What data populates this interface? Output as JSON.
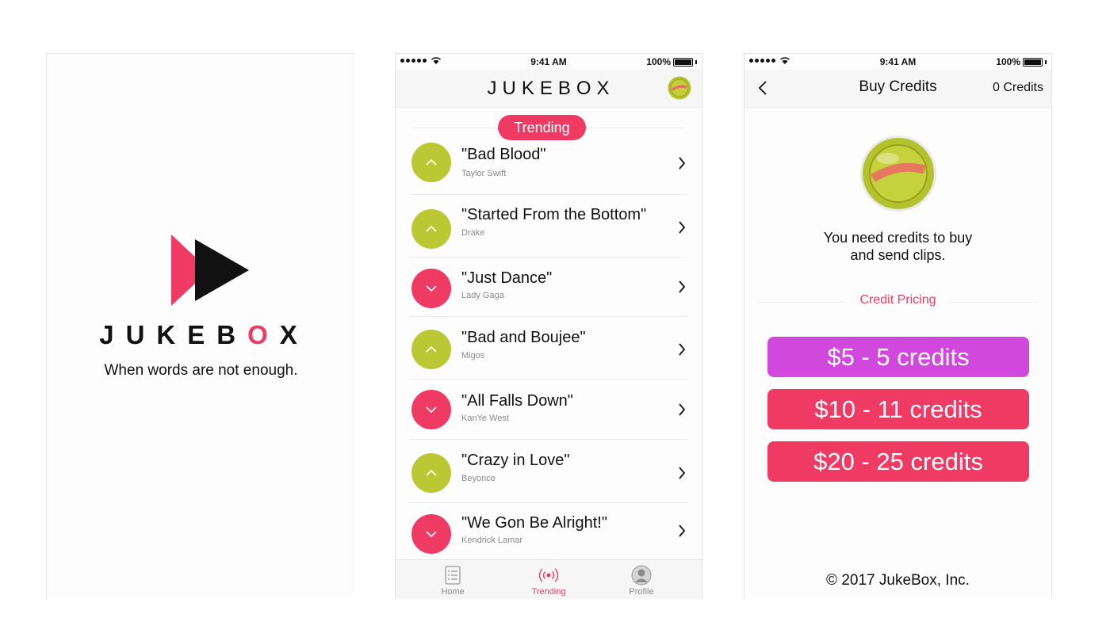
{
  "splash": {
    "brand_letters": [
      "J",
      "U",
      "K",
      "E",
      "B",
      "O",
      "X"
    ],
    "tagline": "When words are not enough."
  },
  "status": {
    "time": "9:41 AM",
    "battery": "100%"
  },
  "trending_screen": {
    "brand": "JUKEBOX",
    "badge": "Trending",
    "songs": [
      {
        "title": "\"Bad Blood\"",
        "artist": "Taylor Swift",
        "vote": "up"
      },
      {
        "title": "\"Started From the Bottom\"",
        "artist": "Drake",
        "vote": "up"
      },
      {
        "title": "\"Just Dance\"",
        "artist": "Lady Gaga",
        "vote": "down"
      },
      {
        "title": "\"Bad and Boujee\"",
        "artist": "Migos",
        "vote": "up"
      },
      {
        "title": "\"All Falls Down\"",
        "artist": "KanYe West",
        "vote": "down"
      },
      {
        "title": "\"Crazy in Love\"",
        "artist": "Beyonce",
        "vote": "up"
      },
      {
        "title": "\"We Gon Be Alright!\"",
        "artist": "Kendrick Lamar",
        "vote": "down"
      }
    ],
    "tabs": [
      {
        "label": "Home",
        "icon": "list-icon",
        "active": false
      },
      {
        "label": "Trending",
        "icon": "broadcast-icon",
        "active": true
      },
      {
        "label": "Profile",
        "icon": "profile-icon",
        "active": false
      }
    ]
  },
  "credits_screen": {
    "title": "Buy Credits",
    "credit_count": "0 Credits",
    "message_line1": "You need credits to buy",
    "message_line2": "and send clips.",
    "pricing_label": "Credit Pricing",
    "options": [
      {
        "label": "$5 - 5 credits",
        "color": "#d148dd"
      },
      {
        "label": "$10 - 11 credits",
        "color": "#ef3b63"
      },
      {
        "label": "$20 - 25 credits",
        "color": "#ef3b63"
      }
    ],
    "copyright": "© 2017 JukeBox, Inc."
  },
  "colors": {
    "accent_pink": "#ef3b63",
    "accent_lime": "#bcc833",
    "accent_purple": "#d148dd"
  }
}
